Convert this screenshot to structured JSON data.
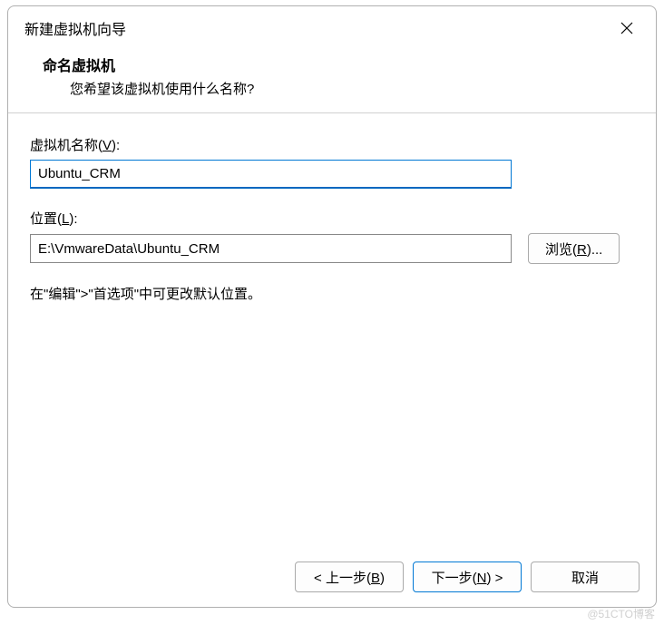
{
  "titlebar": {
    "title": "新建虚拟机向导"
  },
  "header": {
    "title": "命名虚拟机",
    "subtitle": "您希望该虚拟机使用什么名称?"
  },
  "fields": {
    "vm_name": {
      "label_pre": "虚拟机名称(",
      "label_key": "V",
      "label_post": "):",
      "value": "Ubuntu_CRM"
    },
    "location": {
      "label_pre": "位置(",
      "label_key": "L",
      "label_post": "):",
      "value": "E:\\VmwareData\\Ubuntu_CRM",
      "browse_pre": "浏览(",
      "browse_key": "R",
      "browse_post": ")..."
    }
  },
  "hint": "在\"编辑\">\"首选项\"中可更改默认位置。",
  "footer": {
    "back_pre": "< 上一步(",
    "back_key": "B",
    "back_post": ")",
    "next_pre": "下一步(",
    "next_key": "N",
    "next_post": ") >",
    "cancel": "取消"
  },
  "watermark": "@51CTO博客"
}
